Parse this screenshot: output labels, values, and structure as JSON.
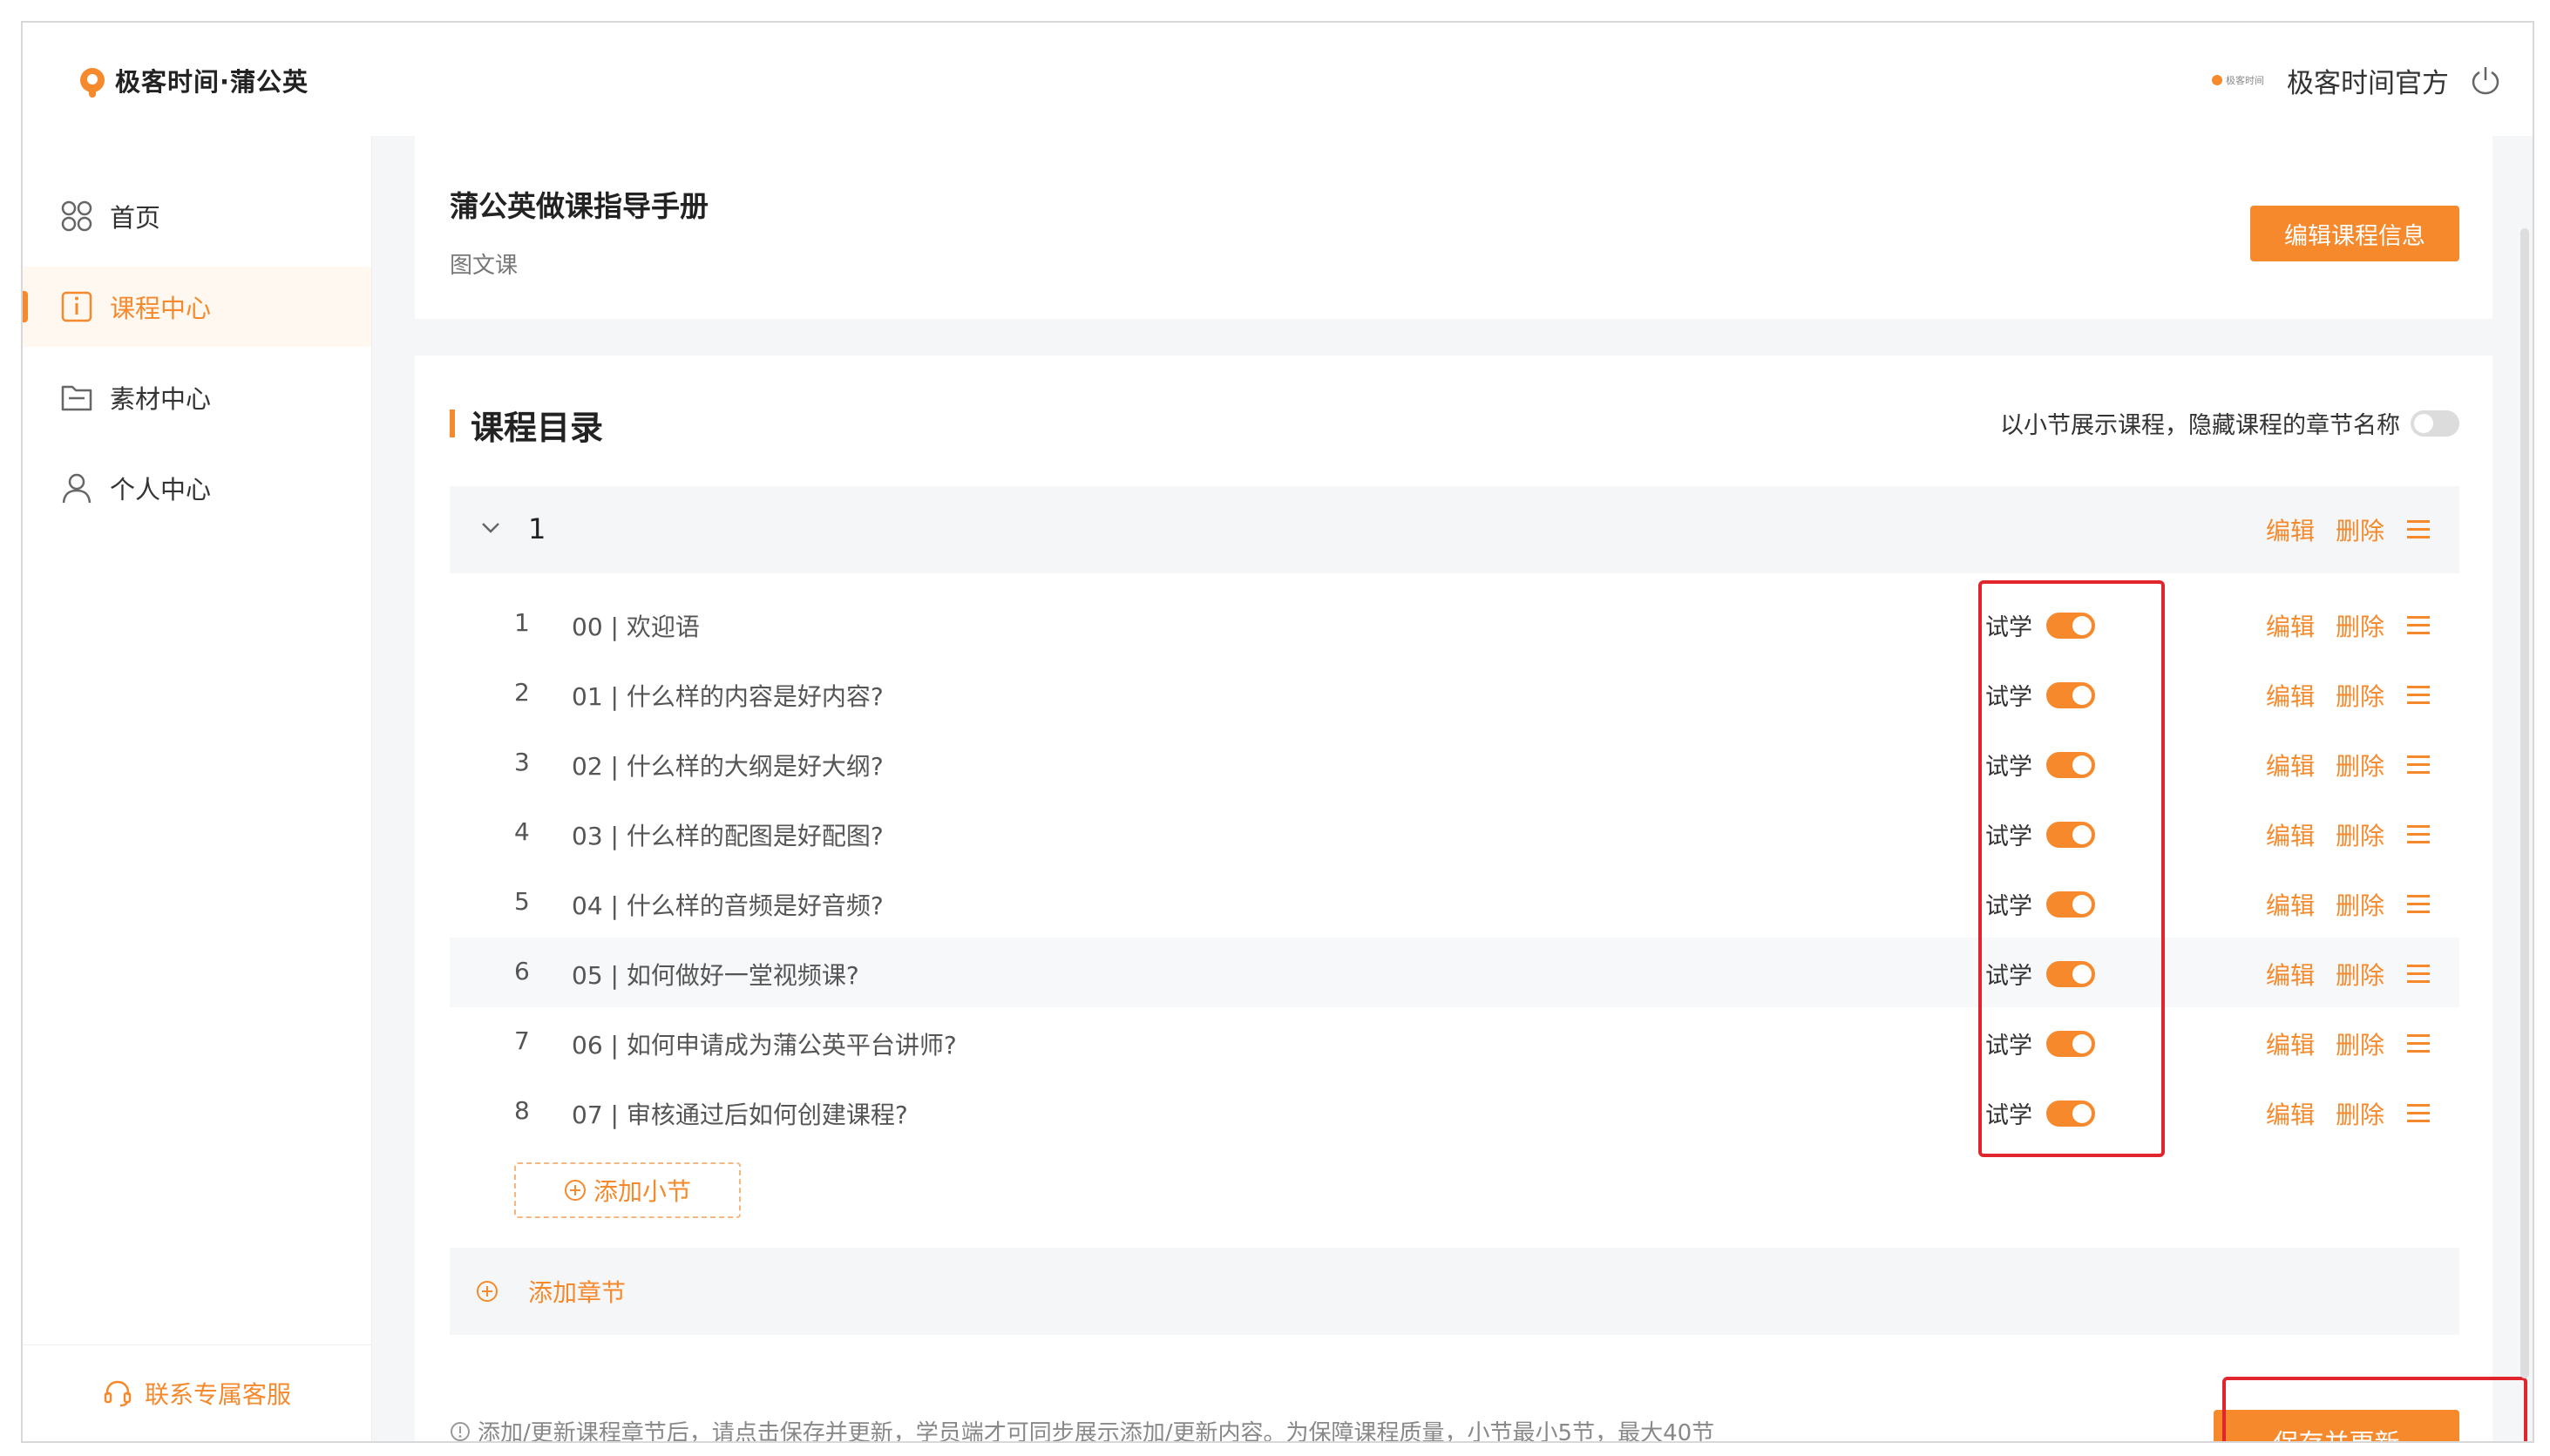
{
  "app": {
    "logo_text": "极客时间·蒲公英"
  },
  "sidebar": {
    "items": [
      {
        "label": "首页",
        "icon": "grid-icon",
        "active": false
      },
      {
        "label": "课程中心",
        "icon": "info-icon",
        "active": true
      },
      {
        "label": "素材中心",
        "icon": "folder-icon",
        "active": false
      },
      {
        "label": "个人中心",
        "icon": "user-icon",
        "active": false
      }
    ],
    "support_label": "联系专属客服"
  },
  "header": {
    "mini_logo_text": "极客时间",
    "username": "极客时间官方",
    "logout_icon": "power-icon"
  },
  "course": {
    "title": "蒲公英做课指导手册",
    "type": "图文课",
    "edit_info_label": "编辑课程信息"
  },
  "catalog": {
    "title": "课程目录",
    "mode_label": "以小节展示课程，隐藏课程的章节名称",
    "mode_enabled": false,
    "chapters": [
      {
        "name": "1",
        "edit_label": "编辑",
        "delete_label": "删除",
        "lessons": [
          {
            "num": "1",
            "title": "00 | 欢迎语",
            "trial_label": "试学",
            "trial": true,
            "edit_label": "编辑",
            "delete_label": "删除"
          },
          {
            "num": "2",
            "title": "01 | 什么样的内容是好内容?",
            "trial_label": "试学",
            "trial": true,
            "edit_label": "编辑",
            "delete_label": "删除"
          },
          {
            "num": "3",
            "title": "02 | 什么样的大纲是好大纲?",
            "trial_label": "试学",
            "trial": true,
            "edit_label": "编辑",
            "delete_label": "删除"
          },
          {
            "num": "4",
            "title": "03 | 什么样的配图是好配图?",
            "trial_label": "试学",
            "trial": true,
            "edit_label": "编辑",
            "delete_label": "删除"
          },
          {
            "num": "5",
            "title": "04 | 什么样的音频是好音频?",
            "trial_label": "试学",
            "trial": true,
            "edit_label": "编辑",
            "delete_label": "删除"
          },
          {
            "num": "6",
            "title": "05 | 如何做好一堂视频课?",
            "trial_label": "试学",
            "trial": true,
            "edit_label": "编辑",
            "delete_label": "删除"
          },
          {
            "num": "7",
            "title": "06 | 如何申请成为蒲公英平台讲师?",
            "trial_label": "试学",
            "trial": true,
            "edit_label": "编辑",
            "delete_label": "删除"
          },
          {
            "num": "8",
            "title": "07 | 审核通过后如何创建课程?",
            "trial_label": "试学",
            "trial": true,
            "edit_label": "编辑",
            "delete_label": "删除"
          }
        ]
      }
    ],
    "add_lesson_label": "添加小节",
    "add_chapter_label": "添加章节",
    "notice": "添加/更新课程章节后，请点击保存并更新，学员端才可同步展示添加/更新内容。为保障课程质量，小节最小5节，最大40节",
    "save_label": "保存并更新"
  },
  "colors": {
    "accent": "#f5892c",
    "highlight_box": "#e0262c",
    "background": "#f5f6f7"
  }
}
